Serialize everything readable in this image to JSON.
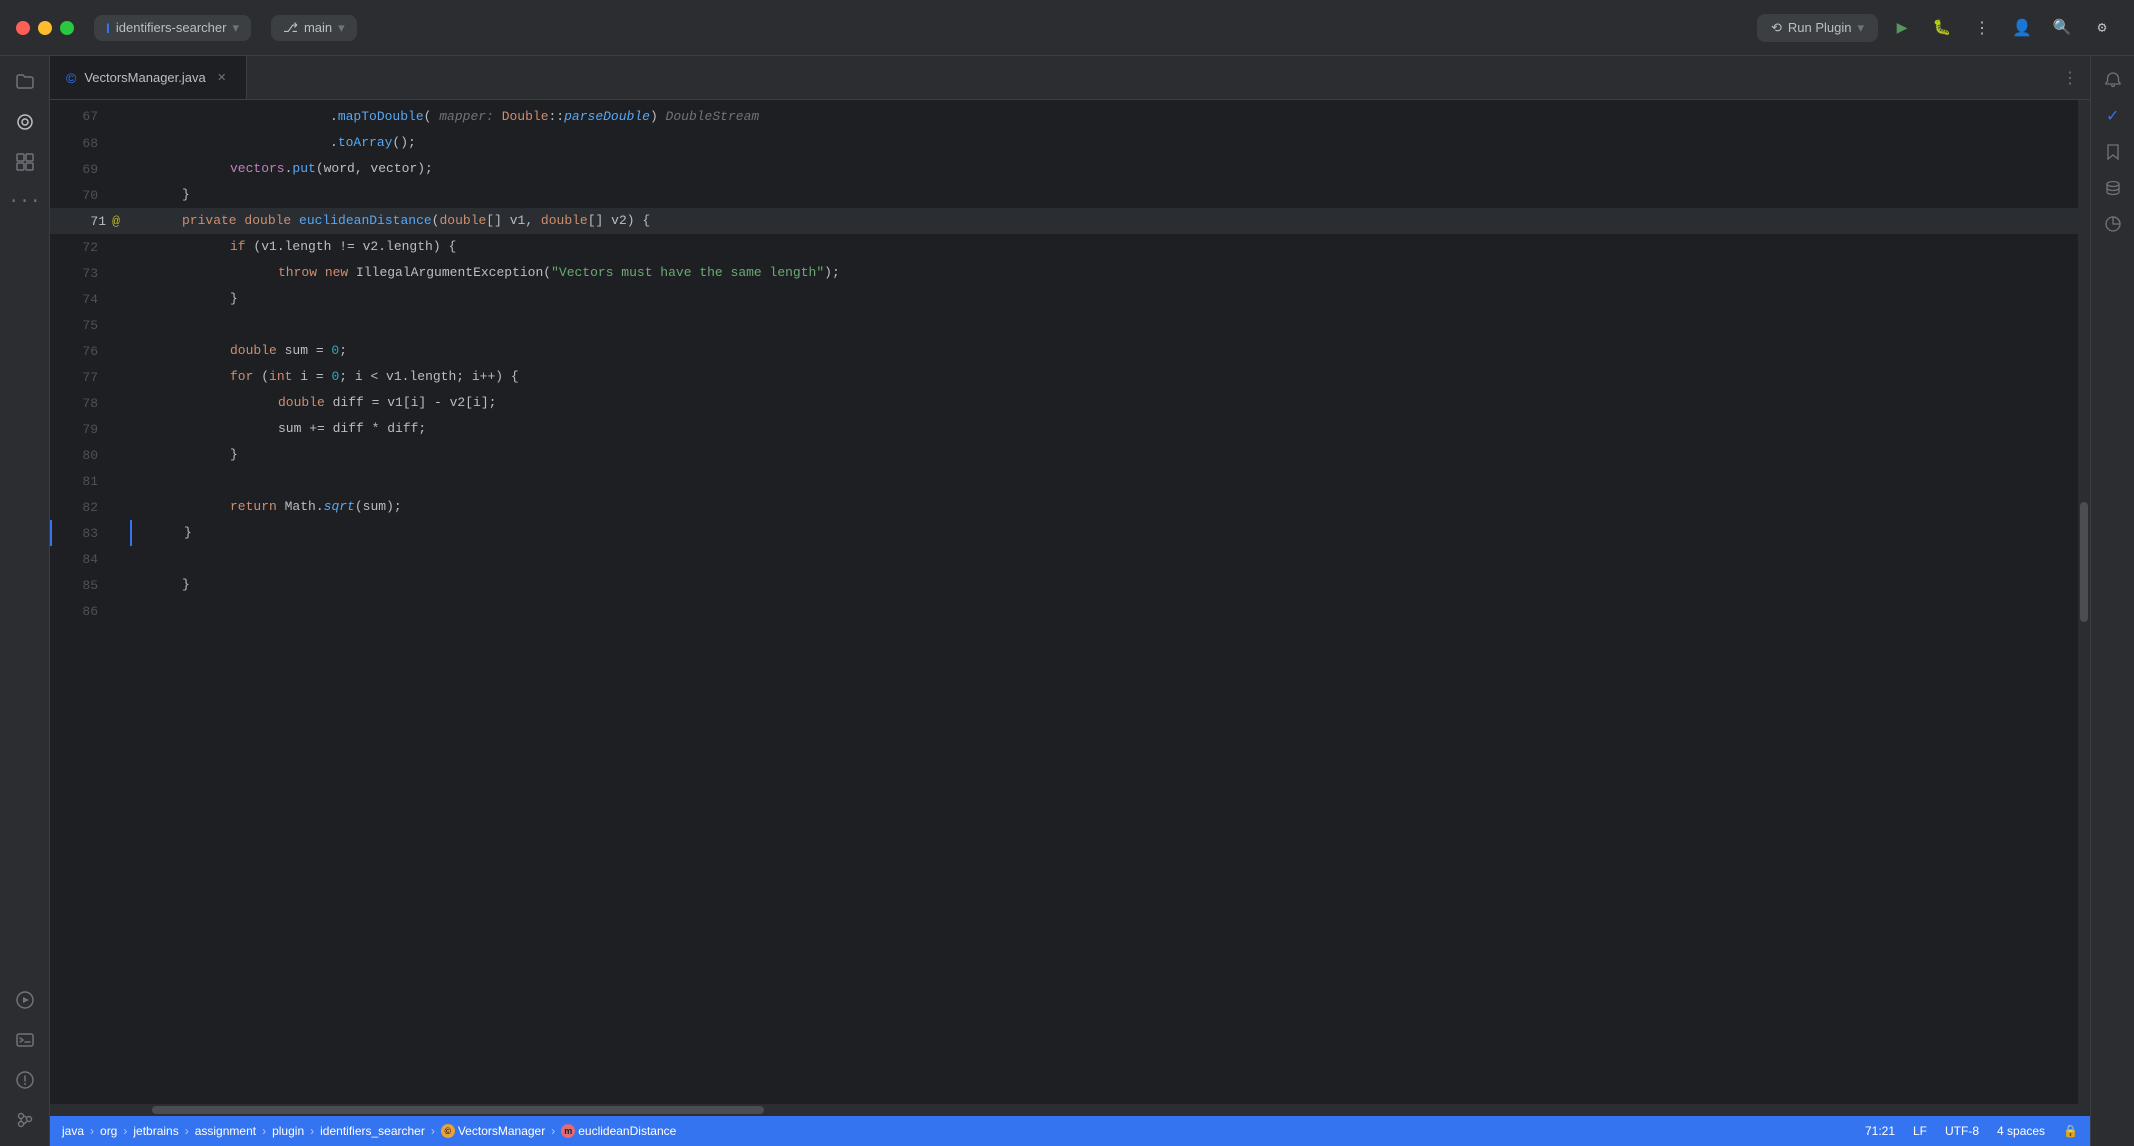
{
  "titlebar": {
    "project_label": "identifiers-searcher",
    "branch_label": "main",
    "run_plugin_label": "Run Plugin",
    "more_icon": "⋮",
    "search_icon": "🔍",
    "settings_icon": "⚙"
  },
  "tabs": [
    {
      "label": "VectorsManager.java",
      "icon": "©",
      "active": true
    }
  ],
  "code": {
    "lines": [
      {
        "num": 67,
        "content": ".mapToDouble( mapper: Double::parseDouble) DoubleStream",
        "type": "normal"
      },
      {
        "num": 68,
        "content": ".toArray();",
        "type": "normal"
      },
      {
        "num": 69,
        "content": "vectors.put(word, vector);",
        "type": "normal"
      },
      {
        "num": 70,
        "content": "}",
        "type": "normal"
      },
      {
        "num": 71,
        "content": "private double euclideanDistance(double[] v1, double[] v2) {",
        "type": "active",
        "annotation": true
      },
      {
        "num": 72,
        "content": "if (v1.length != v2.length) {",
        "type": "normal"
      },
      {
        "num": 73,
        "content": "throw new IllegalArgumentException(\"Vectors must have the same length\");",
        "type": "normal"
      },
      {
        "num": 74,
        "content": "}",
        "type": "normal"
      },
      {
        "num": 75,
        "content": "",
        "type": "normal"
      },
      {
        "num": 76,
        "content": "double sum = 0;",
        "type": "normal"
      },
      {
        "num": 77,
        "content": "for (int i = 0; i < v1.length; i++) {",
        "type": "normal"
      },
      {
        "num": 78,
        "content": "double diff = v1[i] - v2[i];",
        "type": "normal"
      },
      {
        "num": 79,
        "content": "sum += diff * diff;",
        "type": "normal"
      },
      {
        "num": 80,
        "content": "}",
        "type": "normal"
      },
      {
        "num": 81,
        "content": "",
        "type": "normal"
      },
      {
        "num": 82,
        "content": "return Math.sqrt(sum);",
        "type": "normal"
      },
      {
        "num": 83,
        "content": "}",
        "type": "normal"
      },
      {
        "num": 84,
        "content": "",
        "type": "normal"
      },
      {
        "num": 85,
        "content": "}",
        "type": "normal"
      },
      {
        "num": 86,
        "content": "",
        "type": "normal"
      }
    ]
  },
  "statusbar": {
    "breadcrumbs": [
      "java",
      "org",
      "jetbrains",
      "assignment",
      "plugin",
      "identifiers_searcher",
      "VectorsManager",
      "euclideanDistance"
    ],
    "position": "71:21",
    "line_ending": "LF",
    "encoding": "UTF-8",
    "indent": "4 spaces"
  },
  "sidebar_icons": [
    "folder",
    "circle-dot",
    "grid",
    "ellipsis"
  ],
  "sidebar_bottom_icons": [
    "play-circle",
    "terminal",
    "alert-circle",
    "git"
  ],
  "right_sidebar_icons": [
    "bell",
    "diamond",
    "database",
    "chart"
  ]
}
